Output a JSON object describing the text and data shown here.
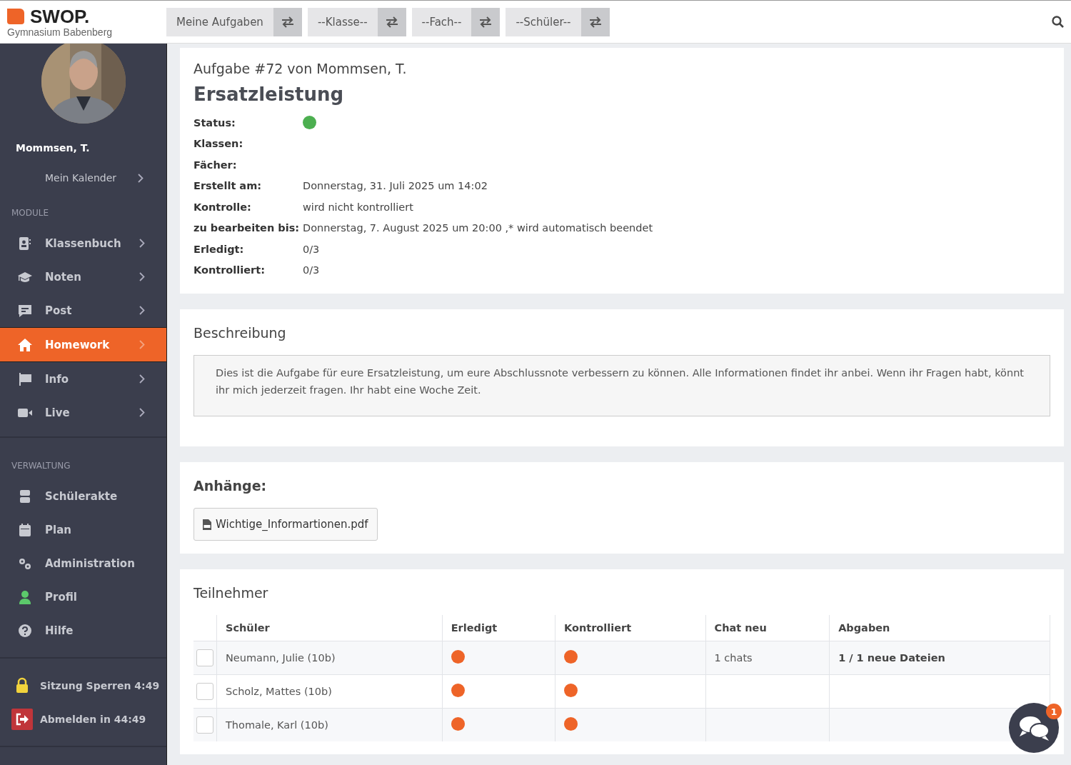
{
  "brand": {
    "name": "SWOP.",
    "school": "Gymnasium Babenberg"
  },
  "filters": [
    {
      "label": "Meine Aufgaben"
    },
    {
      "label": "--Klasse--"
    },
    {
      "label": "--Fach--"
    },
    {
      "label": "--Schüler--"
    }
  ],
  "sidebar": {
    "user": "Mommsen, T.",
    "calendar": "Mein Kalender",
    "sections": [
      {
        "title": "MODULE",
        "kind": "expandable",
        "items": [
          {
            "label": "Klassenbuch",
            "selected": false
          },
          {
            "label": "Noten",
            "selected": false
          },
          {
            "label": "Post",
            "selected": false
          },
          {
            "label": "Homework",
            "selected": true
          },
          {
            "label": "Info",
            "selected": false
          },
          {
            "label": "Live",
            "selected": false
          }
        ]
      },
      {
        "title": "VERWALTUNG",
        "kind": "plain",
        "items": [
          {
            "label": "Schülerakte",
            "selected": false
          },
          {
            "label": "Plan",
            "selected": false
          },
          {
            "label": "Administration",
            "selected": false
          },
          {
            "label": "Profil",
            "selected": false
          },
          {
            "label": "Hilfe",
            "selected": false
          }
        ]
      }
    ],
    "session": [
      "Sitzung Sperren 4:49",
      "Abmelden in 44:49"
    ]
  },
  "task": {
    "heading": "Aufgabe #72 von Mommsen, T.",
    "title": "Ersatzleistung",
    "fields": [
      {
        "label": "Status:",
        "kind": "dot",
        "color": "#4caf50"
      },
      {
        "label": "Klassen:",
        "kind": "text"
      },
      {
        "label": "Fächer:",
        "kind": "text"
      },
      {
        "label": "Erstellt am:",
        "kind": "text",
        "value": "Donnerstag, 31. Juli 2025 um 14:02"
      },
      {
        "label": "Kontrolle:",
        "kind": "text",
        "value": "wird nicht kontrolliert"
      },
      {
        "label": "zu bearbeiten bis:",
        "kind": "text",
        "value": "Donnerstag, 7. August 2025 um 20:00 ,* wird automatisch beendet"
      },
      {
        "label": "Erledigt:",
        "kind": "text",
        "value": "0/3"
      },
      {
        "label": "Kontrolliert:",
        "kind": "text",
        "value": "0/3"
      }
    ]
  },
  "description": {
    "title": "Beschreibung",
    "text": "Dies ist die Aufgabe für eure Ersatzleistung, um eure Abschlussnote verbessern zu können. Alle Informationen findet ihr anbei. Wenn ihr Fragen habt, könnt ihr mich jederzeit fragen. Ihr habt eine Woche Zeit."
  },
  "attachments": {
    "title": "Anhänge:",
    "files": [
      "Wichtige_Informartionen.pdf"
    ]
  },
  "participants": {
    "title": "Teilnehmer",
    "columns": [
      "Schüler",
      "Erledigt",
      "Kontrolliert",
      "Chat neu",
      "Abgaben"
    ],
    "rows": [
      {
        "checked": false,
        "name": "Neumann, Julie (10b)",
        "done": false,
        "controlled": false,
        "chat": "1 chats",
        "submissions": "1 / 1 neue Dateien"
      },
      {
        "checked": false,
        "name": "Scholz, Mattes (10b)",
        "done": false,
        "controlled": false
      },
      {
        "checked": false,
        "name": "Thomale, Karl (10b)",
        "done": false,
        "controlled": false
      }
    ]
  },
  "chat_badge": "1"
}
